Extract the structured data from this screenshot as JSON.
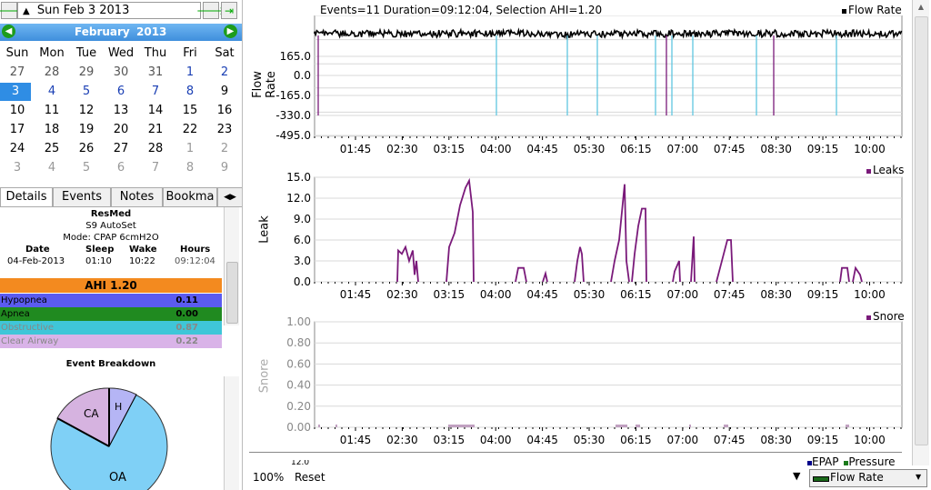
{
  "top": {
    "date_label": "Sun Feb 3 2013"
  },
  "calendar": {
    "month": "February",
    "year": "2013",
    "weekdays": [
      "Sun",
      "Mon",
      "Tue",
      "Wed",
      "Thu",
      "Fri",
      "Sat"
    ],
    "weeks": [
      [
        "27",
        "28",
        "29",
        "30",
        "31",
        "1",
        "2"
      ],
      [
        "3",
        "4",
        "5",
        "6",
        "7",
        "8",
        "9"
      ],
      [
        "10",
        "11",
        "12",
        "13",
        "14",
        "15",
        "16"
      ],
      [
        "17",
        "18",
        "19",
        "20",
        "21",
        "22",
        "23"
      ],
      [
        "24",
        "25",
        "26",
        "27",
        "28",
        "1",
        "2"
      ],
      [
        "3",
        "4",
        "5",
        "6",
        "7",
        "8",
        "9"
      ]
    ]
  },
  "tabs": [
    "Details",
    "Events",
    "Notes",
    "Bookma"
  ],
  "details": {
    "device": "ResMed",
    "model": "S9 AutoSet",
    "mode": "Mode: CPAP 6cmH2O",
    "cols": [
      "Date",
      "Sleep",
      "Wake",
      "Hours"
    ],
    "vals": [
      "04-Feb-2013",
      "01:10",
      "10:22",
      "09:12:04"
    ],
    "ahi_label": "AHI 1.20",
    "indices": [
      {
        "name": "Hypopnea",
        "value": "0.11",
        "bg": "#5b5bf0"
      },
      {
        "name": "Apnea",
        "value": "0.00",
        "bg": "#208a20"
      },
      {
        "name": "Obstructive",
        "value": "0.87",
        "bg": "#3fc6d8"
      },
      {
        "name": "Clear Airway",
        "value": "0.22",
        "bg": "#d9b3e8"
      }
    ],
    "breakdown_title": "Event Breakdown",
    "pie_labels": {
      "ca": "CA",
      "h": "H",
      "oa": "OA"
    }
  },
  "charts": {
    "header": "Events=11 Duration=09:12:04, Selection AHI=1.20",
    "time_ticks": [
      "01:45",
      "02:30",
      "03:15",
      "04:00",
      "04:45",
      "05:30",
      "06:15",
      "07:00",
      "07:45",
      "08:30",
      "09:15",
      "10:00"
    ],
    "flow": {
      "title": "Flow Rate",
      "legend": "Flow Rate",
      "yticks": [
        "165.0",
        "0.0",
        "-165.0",
        "-330.0",
        "-495.0"
      ]
    },
    "leak": {
      "title": "Leak",
      "legend": "Leaks",
      "yticks": [
        "15.0",
        "12.0",
        "9.0",
        "6.0",
        "3.0",
        "0.0"
      ]
    },
    "snore": {
      "title": "Snore",
      "legend": "Snore",
      "yticks": [
        "1.00",
        "0.80",
        "0.60",
        "0.40",
        "0.20",
        "0.00"
      ]
    },
    "pressure": {
      "legend_epap": "EPAP",
      "legend_pressure": "Pressure",
      "partial_tick": "12.0"
    }
  },
  "bottom": {
    "zoom": "100%",
    "reset": "Reset",
    "graph_select": "Flow Rate"
  }
}
